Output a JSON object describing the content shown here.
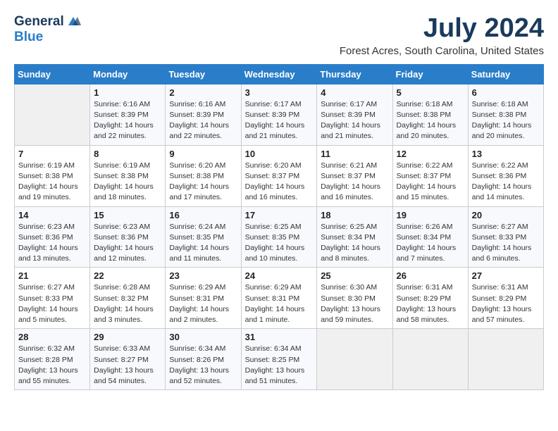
{
  "logo": {
    "general": "General",
    "blue": "Blue"
  },
  "title": "July 2024",
  "subtitle": "Forest Acres, South Carolina, United States",
  "days_header": [
    "Sunday",
    "Monday",
    "Tuesday",
    "Wednesday",
    "Thursday",
    "Friday",
    "Saturday"
  ],
  "weeks": [
    [
      {
        "num": "",
        "info": ""
      },
      {
        "num": "1",
        "info": "Sunrise: 6:16 AM\nSunset: 8:39 PM\nDaylight: 14 hours\nand 22 minutes."
      },
      {
        "num": "2",
        "info": "Sunrise: 6:16 AM\nSunset: 8:39 PM\nDaylight: 14 hours\nand 22 minutes."
      },
      {
        "num": "3",
        "info": "Sunrise: 6:17 AM\nSunset: 8:39 PM\nDaylight: 14 hours\nand 21 minutes."
      },
      {
        "num": "4",
        "info": "Sunrise: 6:17 AM\nSunset: 8:39 PM\nDaylight: 14 hours\nand 21 minutes."
      },
      {
        "num": "5",
        "info": "Sunrise: 6:18 AM\nSunset: 8:38 PM\nDaylight: 14 hours\nand 20 minutes."
      },
      {
        "num": "6",
        "info": "Sunrise: 6:18 AM\nSunset: 8:38 PM\nDaylight: 14 hours\nand 20 minutes."
      }
    ],
    [
      {
        "num": "7",
        "info": "Sunrise: 6:19 AM\nSunset: 8:38 PM\nDaylight: 14 hours\nand 19 minutes."
      },
      {
        "num": "8",
        "info": "Sunrise: 6:19 AM\nSunset: 8:38 PM\nDaylight: 14 hours\nand 18 minutes."
      },
      {
        "num": "9",
        "info": "Sunrise: 6:20 AM\nSunset: 8:38 PM\nDaylight: 14 hours\nand 17 minutes."
      },
      {
        "num": "10",
        "info": "Sunrise: 6:20 AM\nSunset: 8:37 PM\nDaylight: 14 hours\nand 16 minutes."
      },
      {
        "num": "11",
        "info": "Sunrise: 6:21 AM\nSunset: 8:37 PM\nDaylight: 14 hours\nand 16 minutes."
      },
      {
        "num": "12",
        "info": "Sunrise: 6:22 AM\nSunset: 8:37 PM\nDaylight: 14 hours\nand 15 minutes."
      },
      {
        "num": "13",
        "info": "Sunrise: 6:22 AM\nSunset: 8:36 PM\nDaylight: 14 hours\nand 14 minutes."
      }
    ],
    [
      {
        "num": "14",
        "info": "Sunrise: 6:23 AM\nSunset: 8:36 PM\nDaylight: 14 hours\nand 13 minutes."
      },
      {
        "num": "15",
        "info": "Sunrise: 6:23 AM\nSunset: 8:36 PM\nDaylight: 14 hours\nand 12 minutes."
      },
      {
        "num": "16",
        "info": "Sunrise: 6:24 AM\nSunset: 8:35 PM\nDaylight: 14 hours\nand 11 minutes."
      },
      {
        "num": "17",
        "info": "Sunrise: 6:25 AM\nSunset: 8:35 PM\nDaylight: 14 hours\nand 10 minutes."
      },
      {
        "num": "18",
        "info": "Sunrise: 6:25 AM\nSunset: 8:34 PM\nDaylight: 14 hours\nand 8 minutes."
      },
      {
        "num": "19",
        "info": "Sunrise: 6:26 AM\nSunset: 8:34 PM\nDaylight: 14 hours\nand 7 minutes."
      },
      {
        "num": "20",
        "info": "Sunrise: 6:27 AM\nSunset: 8:33 PM\nDaylight: 14 hours\nand 6 minutes."
      }
    ],
    [
      {
        "num": "21",
        "info": "Sunrise: 6:27 AM\nSunset: 8:33 PM\nDaylight: 14 hours\nand 5 minutes."
      },
      {
        "num": "22",
        "info": "Sunrise: 6:28 AM\nSunset: 8:32 PM\nDaylight: 14 hours\nand 3 minutes."
      },
      {
        "num": "23",
        "info": "Sunrise: 6:29 AM\nSunset: 8:31 PM\nDaylight: 14 hours\nand 2 minutes."
      },
      {
        "num": "24",
        "info": "Sunrise: 6:29 AM\nSunset: 8:31 PM\nDaylight: 14 hours\nand 1 minute."
      },
      {
        "num": "25",
        "info": "Sunrise: 6:30 AM\nSunset: 8:30 PM\nDaylight: 13 hours\nand 59 minutes."
      },
      {
        "num": "26",
        "info": "Sunrise: 6:31 AM\nSunset: 8:29 PM\nDaylight: 13 hours\nand 58 minutes."
      },
      {
        "num": "27",
        "info": "Sunrise: 6:31 AM\nSunset: 8:29 PM\nDaylight: 13 hours\nand 57 minutes."
      }
    ],
    [
      {
        "num": "28",
        "info": "Sunrise: 6:32 AM\nSunset: 8:28 PM\nDaylight: 13 hours\nand 55 minutes."
      },
      {
        "num": "29",
        "info": "Sunrise: 6:33 AM\nSunset: 8:27 PM\nDaylight: 13 hours\nand 54 minutes."
      },
      {
        "num": "30",
        "info": "Sunrise: 6:34 AM\nSunset: 8:26 PM\nDaylight: 13 hours\nand 52 minutes."
      },
      {
        "num": "31",
        "info": "Sunrise: 6:34 AM\nSunset: 8:25 PM\nDaylight: 13 hours\nand 51 minutes."
      },
      {
        "num": "",
        "info": ""
      },
      {
        "num": "",
        "info": ""
      },
      {
        "num": "",
        "info": ""
      }
    ]
  ]
}
